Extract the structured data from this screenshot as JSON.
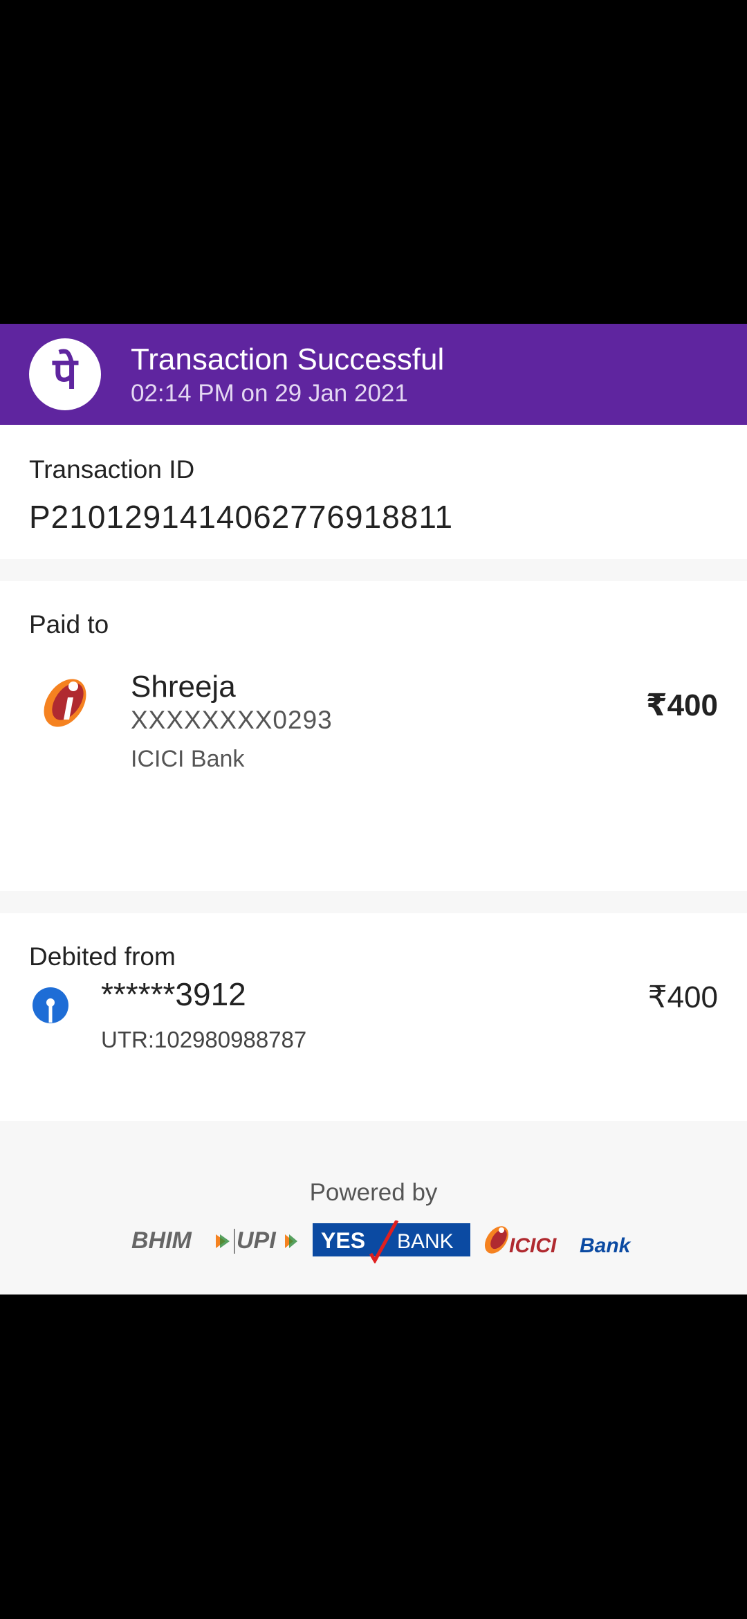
{
  "header": {
    "title": "Transaction Successful",
    "subtitle": "02:14 PM on 29 Jan 2021",
    "brand_icon": "phonepe-logo-icon"
  },
  "transaction": {
    "label": "Transaction ID",
    "id": "P2101291414062776918811"
  },
  "paid_to": {
    "label": "Paid to",
    "name": "Shreeja",
    "account": "XXXXXXXX0293",
    "bank": "ICICI Bank",
    "amount": "₹400",
    "bank_icon": "icici-bank-icon"
  },
  "debited_from": {
    "label": "Debited from",
    "account": "******3912",
    "utr": "UTR:102980988787",
    "amount": "₹400",
    "bank_icon": "sbi-bank-icon"
  },
  "footer": {
    "powered_label": "Powered by",
    "logos": {
      "bhim": "BHIM",
      "upi": "UPI",
      "yes": "YES",
      "bank": "BANK",
      "icici": "ICICI",
      "icici_bank": "Bank"
    }
  },
  "colors": {
    "brand": "#5f259f",
    "icici_orange": "#f58220",
    "icici_red": "#b02a30",
    "sbi_blue": "#1e6dd6",
    "yes_blue": "#0b4aa2"
  }
}
